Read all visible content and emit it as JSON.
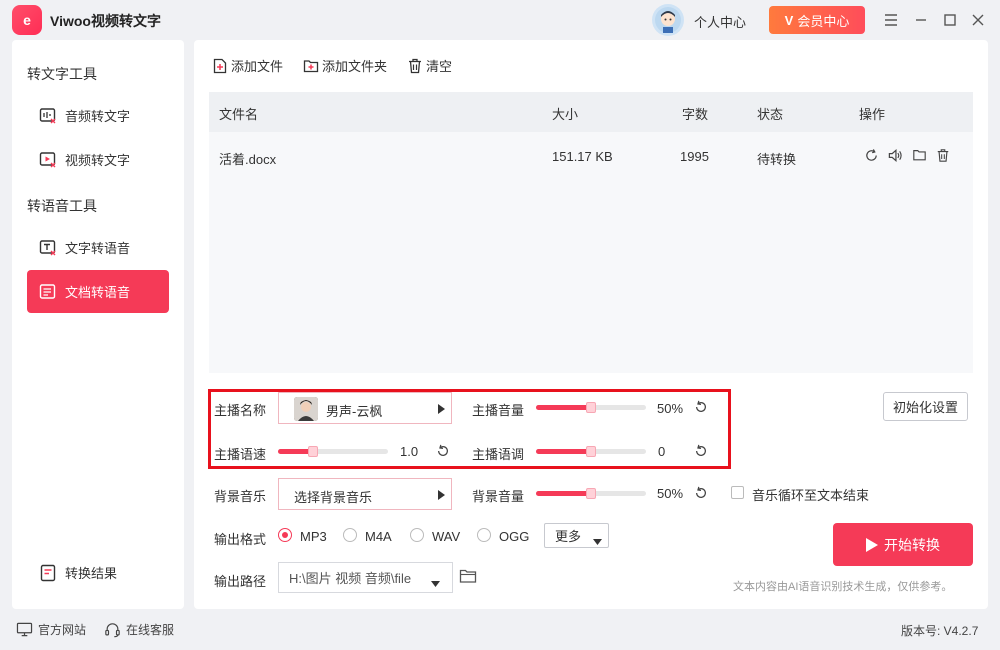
{
  "app": {
    "logo_text": "e",
    "title": "Viwoo视频转文字"
  },
  "header": {
    "user_center": "个人中心",
    "vip_button": "会员中心"
  },
  "window_controls": [
    "menu-icon",
    "minimize-icon",
    "maximize-icon",
    "close-icon"
  ],
  "sidebar": {
    "section1": "转文字工具",
    "items1": [
      {
        "label": "音频转文字",
        "icon": "audio-text-icon"
      },
      {
        "label": "视频转文字",
        "icon": "video-text-icon"
      }
    ],
    "section2": "转语音工具",
    "items2": [
      {
        "label": "文字转语音",
        "icon": "text-speech-icon"
      },
      {
        "label": "文档转语音",
        "icon": "doc-speech-icon",
        "active": true
      }
    ],
    "result": "转换结果"
  },
  "toolbar": {
    "add_file": "添加文件",
    "add_folder": "添加文件夹",
    "clear": "清空"
  },
  "table": {
    "headers": [
      "文件名",
      "大小",
      "字数",
      "状态",
      "操作"
    ],
    "rows": [
      {
        "name": "活着.docx",
        "size": "151.17 KB",
        "words": "1995",
        "status": "待转换"
      }
    ]
  },
  "settings": {
    "anchor_name_label": "主播名称",
    "anchor_name_value": "男声-云枫",
    "anchor_volume_label": "主播音量",
    "anchor_volume_value": "50%",
    "anchor_volume_level": 0.5,
    "anchor_speed_label": "主播语速",
    "anchor_speed_value": "1.0",
    "anchor_speed_level": 0.32,
    "anchor_tone_label": "主播语调",
    "anchor_tone_value": "0",
    "anchor_tone_level": 0.5,
    "bg_music_label": "背景音乐",
    "bg_music_value": "选择背景音乐",
    "bg_volume_label": "背景音量",
    "bg_volume_value": "50%",
    "bg_volume_level": 0.5,
    "loop_label": "音乐循环至文本结束",
    "init_button": "初始化设置",
    "format_label": "输出格式",
    "formats": [
      "MP3",
      "M4A",
      "WAV",
      "OGG"
    ],
    "selected_format": "MP3",
    "more": "更多",
    "path_label": "输出路径",
    "path_value": "H:\\图片 视频 音频\\file"
  },
  "actions": {
    "start": "开始转换",
    "disclaimer": "文本内容由AI语音识别技术生成，仅供参考。"
  },
  "footer": {
    "website": "官方网站",
    "service": "在线客服",
    "version": "版本号: V4.2.7"
  },
  "colors": {
    "accent": "#f53a57",
    "highlight": "#e8111d",
    "vip": "#ff6a45"
  }
}
